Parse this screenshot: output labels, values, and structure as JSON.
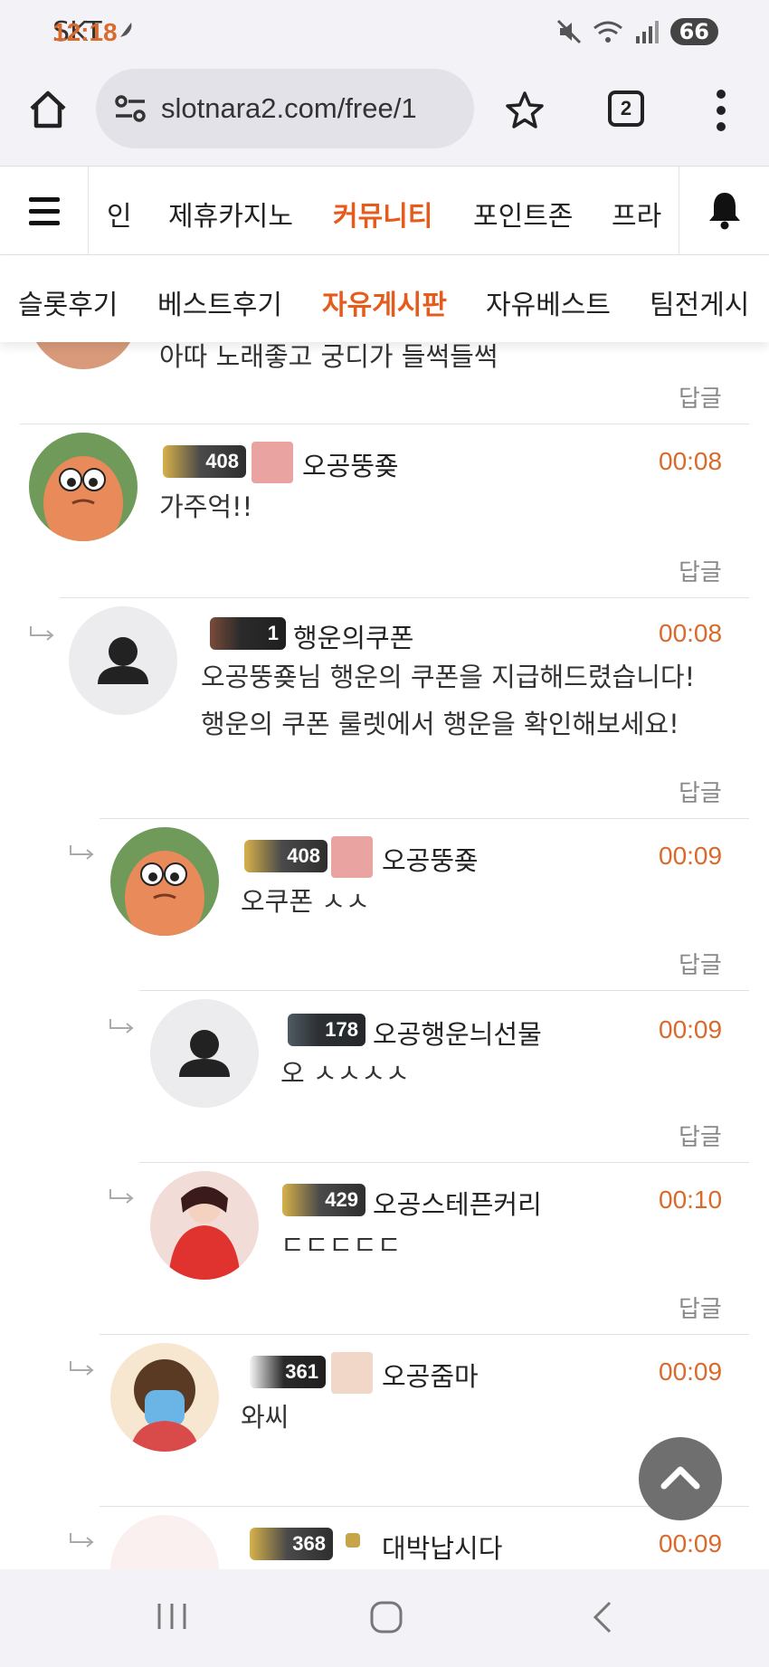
{
  "status": {
    "carrier": "SKT",
    "time": "12:18",
    "battery": "66"
  },
  "browser": {
    "url": "slotnara2.com/free/1",
    "tab_count": "2"
  },
  "site_nav": {
    "items": [
      "인",
      "제휴카지노",
      "커뮤니티",
      "포인트존",
      "프라"
    ],
    "active": "커뮤니티"
  },
  "sub_nav": {
    "items": [
      "슬롯후기",
      "베스트후기",
      "자유게시판",
      "자유베스트",
      "팀전게시"
    ],
    "active": "자유게시판"
  },
  "comments": [
    {
      "text": "아따 노래좋고 궁디가 들썩들썩",
      "reply": "답글"
    },
    {
      "level": "408",
      "nick": "오공뚱죶",
      "time": "00:08",
      "text": "가주억!!",
      "reply": "답글"
    },
    {
      "level": "1",
      "nick": "행운의쿠폰",
      "time": "00:08",
      "text1": "오공뚱죶님 행운의 쿠폰을 지급해드렸습니다!",
      "text2": "행운의 쿠폰 룰렛에서 행운을 확인해보세요!",
      "reply": "답글"
    },
    {
      "level": "408",
      "nick": "오공뚱죶",
      "time": "00:09",
      "text": "오쿠폰 ㅅㅅ",
      "reply": "답글"
    },
    {
      "level": "178",
      "nick": "오공행운늬선물",
      "time": "00:09",
      "text": "오 ㅅㅅㅅㅅ",
      "reply": "답글"
    },
    {
      "level": "429",
      "nick": "오공스테픈커리",
      "time": "00:10",
      "text": "ㄷㄷㄷㄷㄷ",
      "reply": "답글"
    },
    {
      "level": "361",
      "nick": "오공줌마",
      "time": "00:09",
      "text": "와씨",
      "reply": "답글"
    },
    {
      "level": "368",
      "nick": "대박납시다",
      "time": "00:09"
    }
  ],
  "colors": {
    "accent": "#e65b1c",
    "time": "#d96a2b"
  }
}
